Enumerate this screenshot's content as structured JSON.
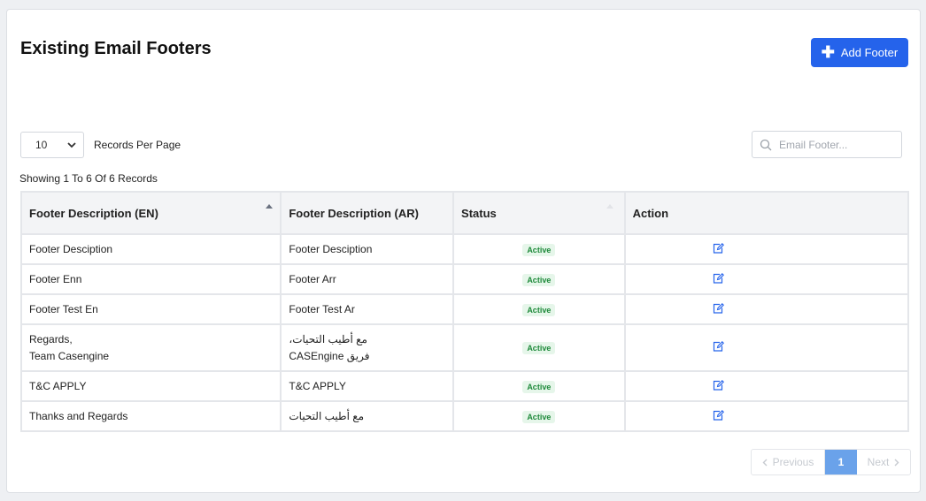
{
  "header": {
    "title": "Existing Email Footers",
    "add_button_label": "Add Footer"
  },
  "toolbar": {
    "per_page_value": "10",
    "per_page_label": "Records Per Page",
    "search_placeholder": "Email Footer..."
  },
  "summary": "Showing 1 To 6 Of 6 Records",
  "table": {
    "columns": [
      "Footer Description (EN)",
      "Footer Description (AR)",
      "Status",
      "Action"
    ],
    "rows": [
      {
        "en": [
          "Footer Desciption"
        ],
        "ar": [
          "Footer Desciption"
        ],
        "status": "Active"
      },
      {
        "en": [
          "Footer Enn"
        ],
        "ar": [
          "Footer Arr"
        ],
        "status": "Active"
      },
      {
        "en": [
          "Footer Test En"
        ],
        "ar": [
          "Footer Test Ar"
        ],
        "status": "Active"
      },
      {
        "en": [
          "Regards,",
          "Team Casengine"
        ],
        "ar": [
          "مع أطيب التحيات،",
          "فريق CASEngine"
        ],
        "status": "Active"
      },
      {
        "en": [
          "T&C APPLY"
        ],
        "ar": [
          "T&C APPLY"
        ],
        "status": "Active"
      },
      {
        "en": [
          "Thanks and Regards"
        ],
        "ar": [
          "مع أطيب التحيات"
        ],
        "status": "Active"
      }
    ]
  },
  "pagination": {
    "previous_label": "Previous",
    "current_page": "1",
    "next_label": "Next"
  },
  "colors": {
    "accent": "#2563eb",
    "active_badge_bg": "#e6f6ea",
    "active_badge_text": "#1f8a3b",
    "current_page_bg": "#6aa2ea"
  },
  "icons": {
    "add": "plus-icon",
    "select": "chevron-down-icon",
    "search": "search-icon",
    "edit": "edit-icon",
    "prev": "chevron-left-icon",
    "next": "chevron-right-icon"
  }
}
